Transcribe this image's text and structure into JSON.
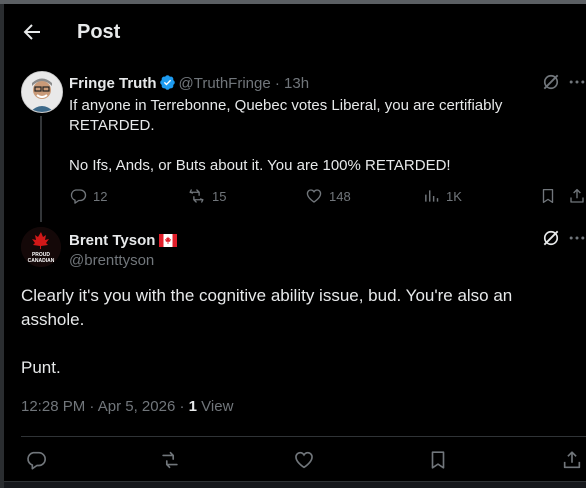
{
  "header": {
    "title": "Post"
  },
  "tweet1": {
    "name": "Fringe Truth",
    "handle": "@TruthFringe",
    "time": "13h",
    "text": "If anyone in Terrebonne, Quebec votes Liberal, you are certifiably\nRETARDED.\n\nNo Ifs, Ands, or Buts about it. You are 100% RETARDED!",
    "replies": "12",
    "reposts": "15",
    "likes": "148",
    "views": "1K"
  },
  "tweet2": {
    "name": "Brent Tyson",
    "handle": "@brenttyson",
    "text": "Clearly it's you with the cognitive ability issue, bud. You're also an\nasshole.\n\nPunt.",
    "time": "12:28 PM",
    "date": "Apr 5, 2026",
    "view_count": "1",
    "view_label": "View"
  },
  "colors": {
    "accent": "#1d9bf0",
    "muted": "#71767b",
    "text": "#e7e9ea",
    "background": "#000000"
  },
  "icons": [
    "back-arrow-icon",
    "verified-badge-icon",
    "grok-icon",
    "more-icon",
    "reply-icon",
    "repost-icon",
    "like-icon",
    "views-icon",
    "bookmark-icon",
    "share-icon",
    "canada-flag-icon"
  ]
}
